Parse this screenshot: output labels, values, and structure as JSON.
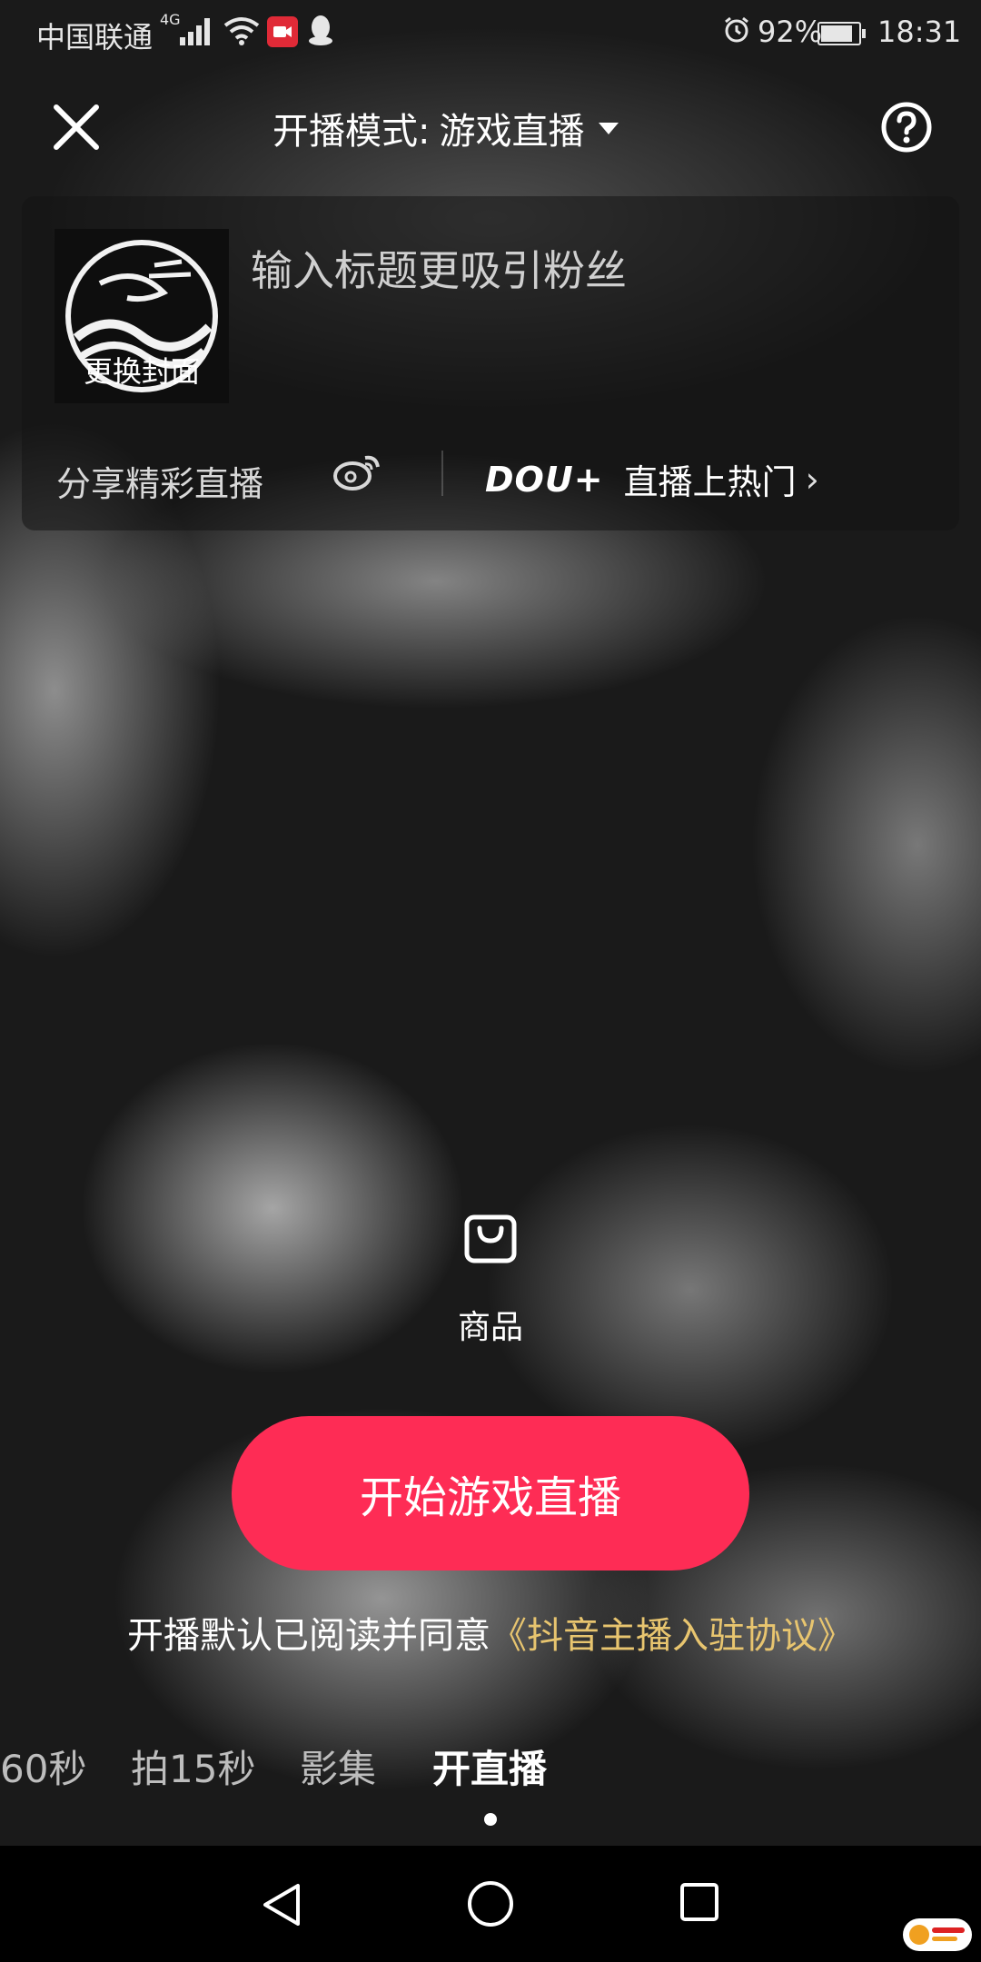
{
  "status_bar": {
    "carrier": "中国联通",
    "network_type": "4G",
    "battery_percent": "92%",
    "time": "18:31",
    "icons": [
      "signal-icon",
      "wifi-icon",
      "screen-record-icon",
      "qq-icon",
      "alarm-icon",
      "battery-icon"
    ],
    "battery_level": 0.92
  },
  "header": {
    "mode_label": "开播模式:",
    "mode_value": "游戏直播",
    "icons": [
      "close-icon",
      "dropdown-caret-icon",
      "help-icon"
    ]
  },
  "setup_card": {
    "cover_label": "更换封面",
    "title_placeholder": "输入标题更吸引粉丝",
    "title_value": "",
    "share_label": "分享精彩直播",
    "share_icon": "weibo-icon",
    "dou_logo": "DOU+",
    "dou_text": "直播上热门",
    "dou_chevron": "›"
  },
  "products": {
    "label": "商品",
    "icon": "shopping-bag-icon"
  },
  "start_button": {
    "label": "开始游戏直播",
    "color": "#fe2c55"
  },
  "agreement": {
    "text": "开播默认已阅读并同意",
    "link": "《抖音主播入驻协议》",
    "link_color": "#e8c56f"
  },
  "mode_tabs": {
    "items": [
      "60秒",
      "拍15秒",
      "影集",
      "开直播"
    ],
    "selected": "开直播"
  },
  "nav_bar": {
    "icons": [
      "back-icon",
      "home-icon",
      "recent-apps-icon"
    ]
  },
  "watermark": {
    "logo": "watermark-logo"
  }
}
